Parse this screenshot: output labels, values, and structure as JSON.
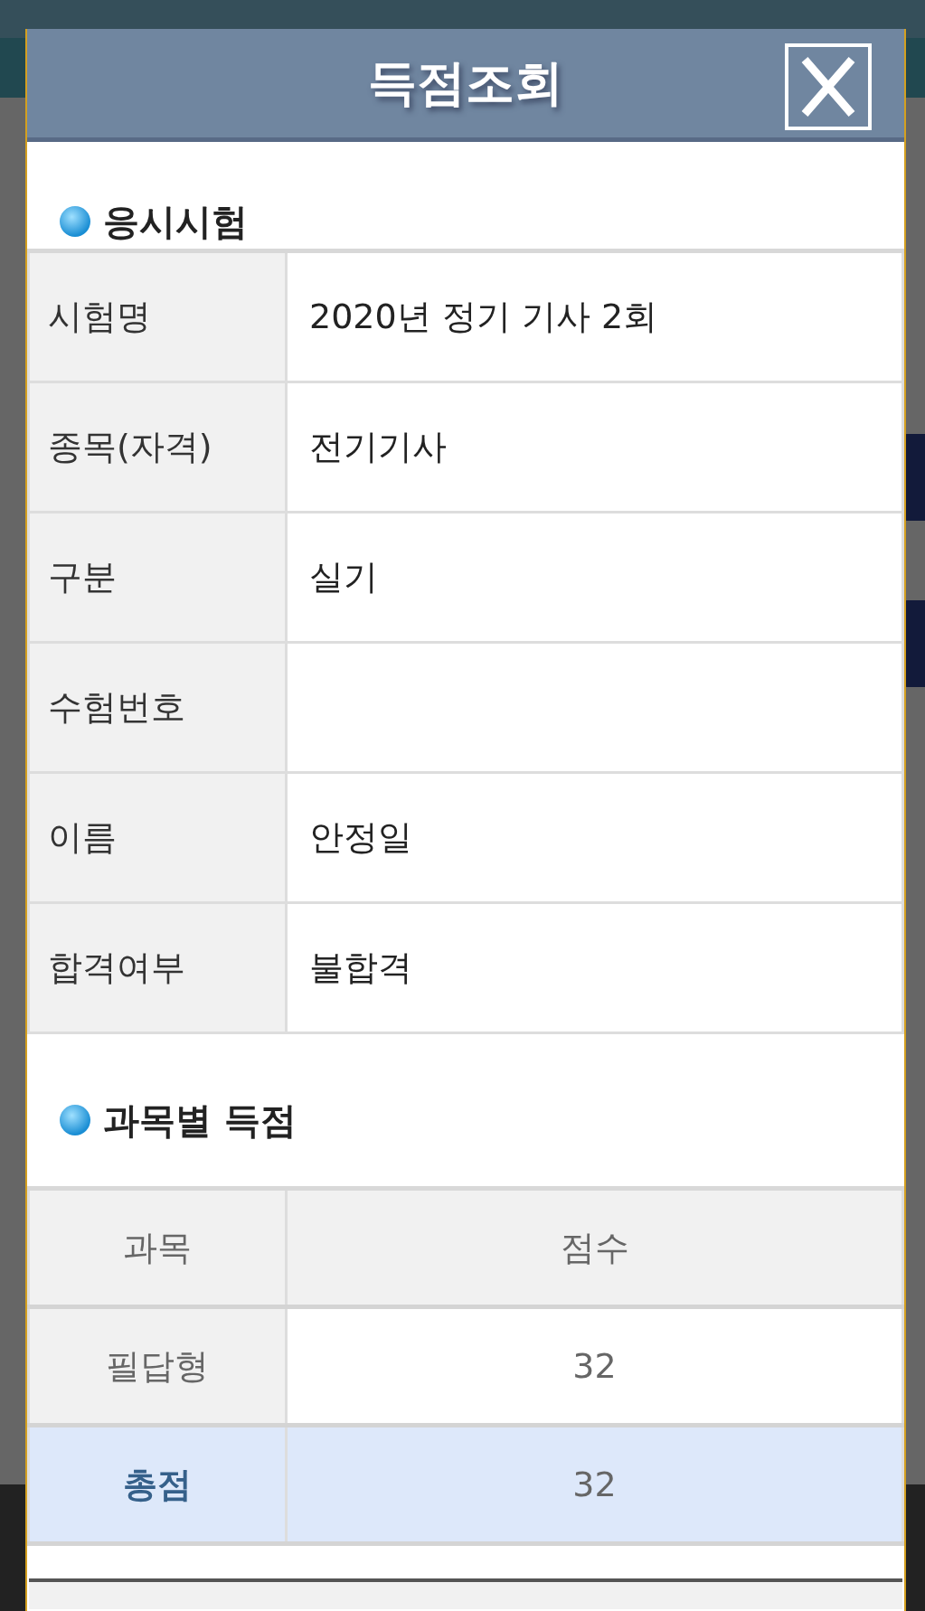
{
  "dialog": {
    "title": "득점조회"
  },
  "exam_section": {
    "heading": "응시시험",
    "rows": [
      {
        "label": "시험명",
        "value": "2020년 정기 기사 2회"
      },
      {
        "label": "종목(자격)",
        "value": "전기기사"
      },
      {
        "label": "구분",
        "value": "실기"
      },
      {
        "label": "수험번호"
      },
      {
        "label": "이름",
        "value": "안정일"
      },
      {
        "label": "합격여부",
        "value": "불합격"
      }
    ]
  },
  "score_section": {
    "heading": "과목별 득점",
    "columns": [
      "과목",
      "점수"
    ],
    "rows": [
      {
        "kind": "subject",
        "subject": "필답형",
        "score": "32"
      },
      {
        "kind": "total",
        "subject": "총점",
        "score": "32"
      }
    ]
  }
}
